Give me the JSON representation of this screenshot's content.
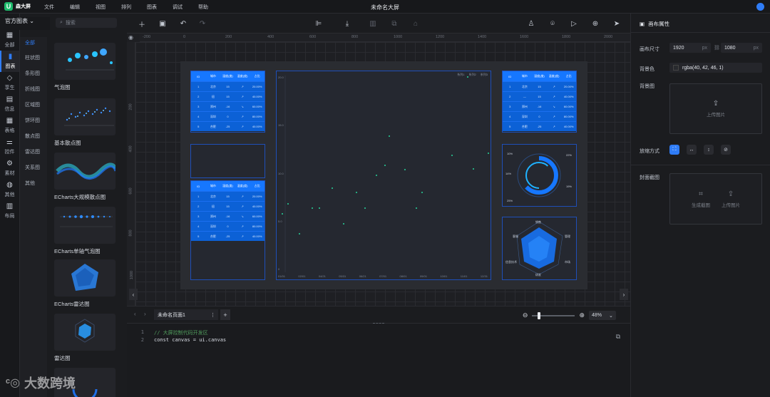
{
  "app": {
    "name": "森大屏",
    "doc_title": "未命名大屏"
  },
  "menu": [
    "文件",
    "编辑",
    "视图",
    "排列",
    "图表",
    "调试",
    "帮助"
  ],
  "left_tabs": [
    {
      "label": "全部",
      "icon": "grid-icon"
    },
    {
      "label": "图表",
      "icon": "bar-chart-icon",
      "active": true
    },
    {
      "label": "享生",
      "icon": "diamond-icon"
    },
    {
      "label": "信息",
      "icon": "document-icon"
    },
    {
      "label": "表格",
      "icon": "table-icon"
    },
    {
      "label": "控件",
      "icon": "slider-icon"
    },
    {
      "label": "素材",
      "icon": "gear-icon"
    },
    {
      "label": "其他",
      "icon": "globe-icon"
    },
    {
      "label": "布局",
      "icon": "layout-icon"
    }
  ],
  "library": {
    "category": "官方图表",
    "search_placeholder": "搜索",
    "subcategories": [
      "全部",
      "柱状图",
      "条形图",
      "折线图",
      "区域图",
      "饼环图",
      "散点图",
      "雷达图",
      "关系图",
      "其他"
    ],
    "items": [
      "气泡图",
      "基本散点图",
      "ECharts大规模散点图",
      "ECharts单轴气泡图",
      "ECharts雷达图",
      "雷达图"
    ]
  },
  "ruler": {
    "top": [
      "-200",
      "0",
      "200",
      "400",
      "600",
      "800",
      "1000",
      "1200",
      "1400",
      "1600",
      "1800",
      "2000"
    ],
    "left": [
      "200",
      "400",
      "600",
      "800",
      "1000"
    ]
  },
  "tables": {
    "headers": [
      "ID",
      "城市",
      "湿度(度)",
      "温度(度)",
      "占比"
    ],
    "rows": [
      [
        "1",
        "北京",
        "15",
        "",
        "20.00%"
      ],
      [
        "2",
        "纽",
        "15",
        "",
        "40.00%"
      ],
      [
        "3",
        "郑州",
        "-16",
        "",
        "60.00%"
      ],
      [
        "4",
        "深圳",
        "0",
        "",
        "80.00%"
      ],
      [
        "5",
        "合肥",
        "-25",
        "",
        "40.00%"
      ]
    ]
  },
  "scatter_panel": {
    "legend": [
      "系列1",
      "系列2",
      "系列3"
    ],
    "y_ticks": [
      "20.0",
      "15.0",
      "10.0",
      "5.0",
      "0"
    ],
    "x_ticks": [
      "01/01",
      "02/01",
      "04/21",
      "05/31",
      "06/21",
      "07/01",
      "08/01",
      "09/01",
      "10/01",
      "11/01",
      "12/31"
    ]
  },
  "ring_panel": {
    "labels": [
      "10%",
      "22%",
      "14%",
      "19%",
      "25%"
    ]
  },
  "radar_panel": {
    "labels": [
      "销售",
      "管理",
      "市场",
      "研发",
      "客服",
      "信息技术"
    ]
  },
  "pages": {
    "current": "未命名页面1"
  },
  "zoom": {
    "value": "48%",
    "fraction": 0.12
  },
  "code": {
    "lines": [
      {
        "no": "1",
        "text": "// 大屏控制代码开发区",
        "kind": "comment"
      },
      {
        "no": "2",
        "text": "const canvas = ui.canvas",
        "kind": "code"
      }
    ]
  },
  "props": {
    "title": "画布属性",
    "size_label": "画布尺寸",
    "width": "1920",
    "height": "1080",
    "unit": "px",
    "bg_color_label": "背景色",
    "bg_color": "rgba(40, 42, 46, 1)",
    "bg_image_label": "背景图",
    "upload_text": "上传图片",
    "scale_label": "放缩方式",
    "cover_label": "封面截图",
    "cover_generate": "生成截图",
    "cover_upload": "上传图片"
  },
  "watermark": {
    "text": "大数跨境"
  },
  "colors": {
    "accent": "#2f7cf6",
    "panel_blue": "#1677ff",
    "green": "#1dba6b"
  }
}
